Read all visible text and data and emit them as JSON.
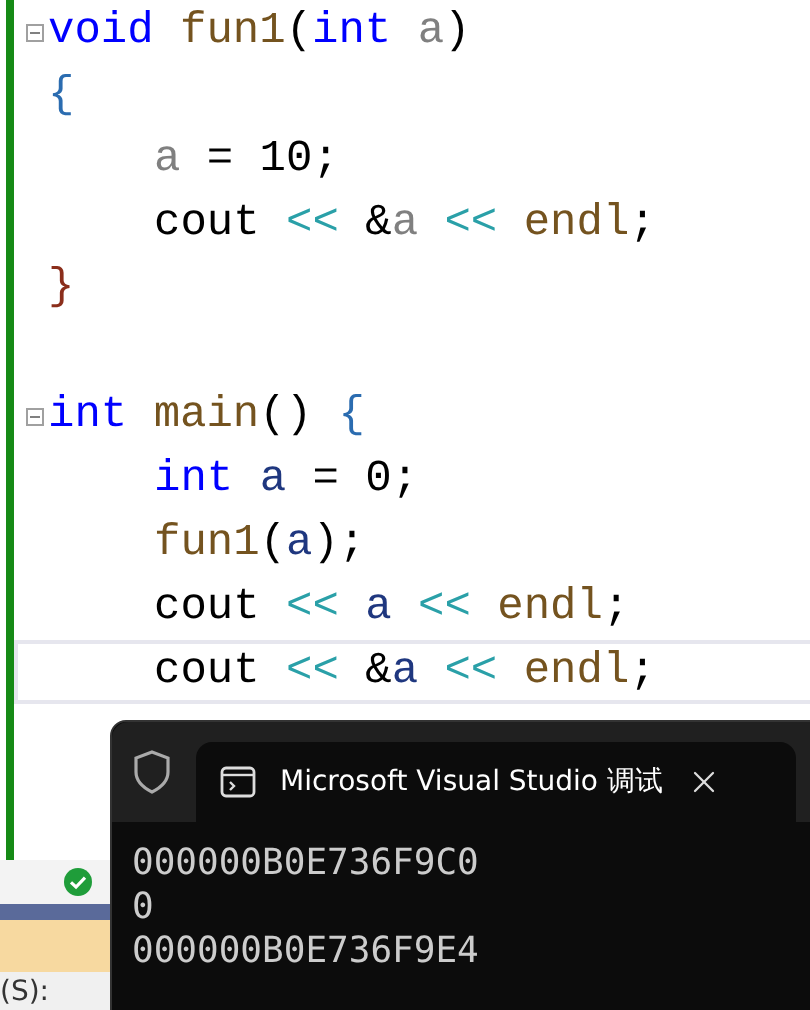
{
  "editor": {
    "lines": [
      {
        "fold": true,
        "current": false,
        "tokens": [
          {
            "text": "void ",
            "kind": "keyword"
          },
          {
            "text": "fun1",
            "kind": "function"
          },
          {
            "text": "(",
            "kind": "plain"
          },
          {
            "text": "int ",
            "kind": "keyword"
          },
          {
            "text": "a",
            "kind": "param"
          },
          {
            "text": ")",
            "kind": "plain"
          }
        ]
      },
      {
        "fold": false,
        "current": false,
        "tokens": [
          {
            "text": "{",
            "kind": "brace"
          }
        ],
        "children": [
          {
            "fold": false,
            "current": false,
            "tokens": [
              {
                "text": "a",
                "kind": "param"
              },
              {
                "text": " = 10;",
                "kind": "plain"
              }
            ]
          },
          {
            "fold": false,
            "current": false,
            "tokens": [
              {
                "text": "cout ",
                "kind": "plain"
              },
              {
                "text": "<<",
                "kind": "operator"
              },
              {
                "text": " &",
                "kind": "plain"
              },
              {
                "text": "a ",
                "kind": "param"
              },
              {
                "text": "<< ",
                "kind": "operator"
              },
              {
                "text": "endl",
                "kind": "function"
              },
              {
                "text": ";",
                "kind": "plain"
              }
            ]
          }
        ]
      },
      {
        "fold": false,
        "current": false,
        "tokens": [
          {
            "text": "}",
            "kind": "closebrace"
          }
        ]
      },
      {
        "fold": false,
        "current": false
      },
      {
        "fold": true,
        "current": false,
        "tokens": [
          {
            "text": "int ",
            "kind": "keyword"
          },
          {
            "text": "main",
            "kind": "function"
          },
          {
            "text": "() ",
            "kind": "plain"
          },
          {
            "text": "{",
            "kind": "brace"
          }
        ],
        "children": [
          {
            "fold": false,
            "current": false,
            "tokens": [
              {
                "text": "int ",
                "kind": "keyword"
              },
              {
                "text": "a",
                "kind": "local"
              },
              {
                "text": " = 0;",
                "kind": "plain"
              }
            ]
          },
          {
            "fold": false,
            "current": false,
            "tokens": [
              {
                "text": "fun1",
                "kind": "function"
              },
              {
                "text": "(",
                "kind": "plain"
              },
              {
                "text": "a",
                "kind": "local"
              },
              {
                "text": ");",
                "kind": "plain"
              }
            ]
          },
          {
            "fold": false,
            "current": false,
            "tokens": [
              {
                "text": "cout ",
                "kind": "plain"
              },
              {
                "text": "<< ",
                "kind": "operator"
              },
              {
                "text": "a ",
                "kind": "local"
              },
              {
                "text": "<< ",
                "kind": "operator"
              },
              {
                "text": "endl",
                "kind": "function"
              },
              {
                "text": ";",
                "kind": "plain"
              }
            ]
          },
          {
            "fold": false,
            "current": true,
            "tokens": [
              {
                "text": "cout ",
                "kind": "plain"
              },
              {
                "text": "<<",
                "kind": "operator"
              },
              {
                "text": " &",
                "kind": "plain"
              },
              {
                "text": "a ",
                "kind": "local"
              },
              {
                "text": "<< ",
                "kind": "operator"
              },
              {
                "text": "endl",
                "kind": "function"
              },
              {
                "text": ";",
                "kind": "plain"
              }
            ]
          }
        ]
      }
    ]
  },
  "status_bar": {
    "label": "(S):"
  },
  "console": {
    "title": "Microsoft Visual Studio 调试",
    "output": [
      "000000B0E736F9C0",
      "0",
      "000000B0E736F9E4"
    ]
  }
}
